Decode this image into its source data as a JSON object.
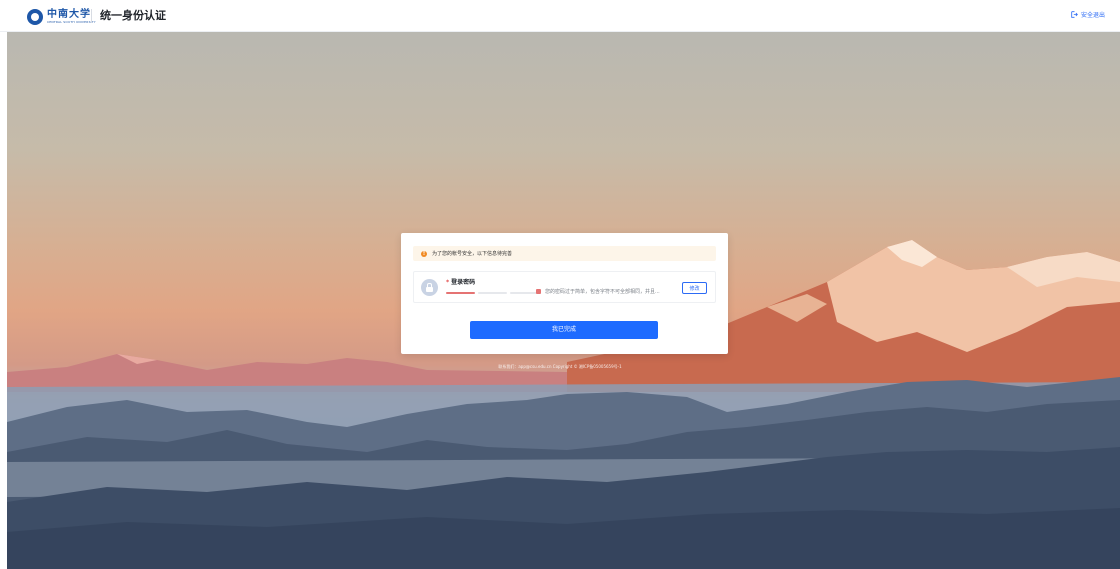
{
  "header": {
    "logo_cn": "中南大学",
    "logo_en": "CENTRAL SOUTH UNIVERSITY",
    "system_title": "统一身份认证",
    "logout_label": "安全退出",
    "logout_icon": "logout-icon"
  },
  "notice": {
    "icon": "warning-icon",
    "text": "为了您的帐号安全，以下信息待完善"
  },
  "password_item": {
    "required_mark": "*",
    "label": "登录密码",
    "strength_level": "弱",
    "hint": "您的密码过于简单，包含字符不可全部相同，并且...",
    "edit_label": "修改",
    "icon": "lock-icon"
  },
  "done_label": "我已完成",
  "footer_text": "联系我们：app@csu.edu.cn  Copyright © 湘ICP备05005659号-1",
  "colors": {
    "accent": "#1e6bff",
    "warning": "#f08a24",
    "weak": "#e57373"
  }
}
